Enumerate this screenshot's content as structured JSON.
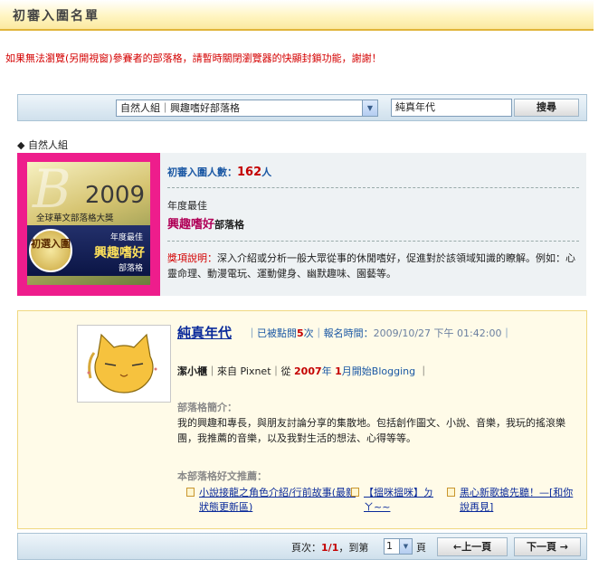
{
  "header": {
    "title": "初審入圍名單"
  },
  "notice": "如果無法瀏覽(另開視窗)參賽者的部落格，請暫時關閉瀏覽器的快顯封鎖功能，謝謝！",
  "search": {
    "group_select": "自然人組｜興趣嗜好部落格",
    "keyword": "純真年代",
    "button": "搜尋"
  },
  "group_label": "◆ 自然人組",
  "badge": {
    "year": "2009",
    "award": "全球華文部落格大獎",
    "circle": "初選入圍",
    "line1": "年度最佳",
    "line2": "興趣嗜好",
    "line3": "部落格"
  },
  "summary": {
    "count_label": "初審入圍人數：",
    "count": "162",
    "count_unit": "人",
    "year_best": "年度最佳",
    "category": "興趣嗜好",
    "category_suffix": "部落格",
    "desc_label": "獎項說明：",
    "desc": "深入介紹或分析一般大眾從事的休閒嗜好，促進對於該領域知識的瞭解。例如：心靈命理、動漫電玩、運動健身、幽默趣味、園藝等。"
  },
  "entry": {
    "title": "純真年代",
    "clicks_prefix": "｜已被點閱",
    "clicks": "5",
    "clicks_suffix": "次｜報名時間：",
    "time": "2009/10/27 下午 01:42:00",
    "time_suffix": "｜",
    "author": "潔小櫃",
    "platform": "｜來自 Pixnet｜從",
    "start_year": "2007",
    "year_unit": "年",
    "start_month": "1",
    "month_suffix": "月開始Blogging",
    "end_bar": "｜",
    "intro_heading": "部落格簡介：",
    "intro": "我的興趣和專長，與朋友討論分享的集散地。包括創作圖文、小說、音樂，我玩的搖滾樂團，我推薦的音樂，以及我對生活的想法、心得等等。",
    "posts_heading": "本部落格好文推薦：",
    "posts": [
      "小說接龍之角色介紹/行前故事(最新狀態更新區)",
      "【搵咪搵咪】ㄉㄚ~~",
      "黑心新歌搶先聽！—[和你說再見]"
    ]
  },
  "pager": {
    "label": "頁次：",
    "current": "1",
    "sep": "/",
    "total": "1",
    "goto": "，到第",
    "page_select": "1",
    "page_unit": "頁",
    "prev": "←上一頁",
    "next": "下一頁 →"
  }
}
